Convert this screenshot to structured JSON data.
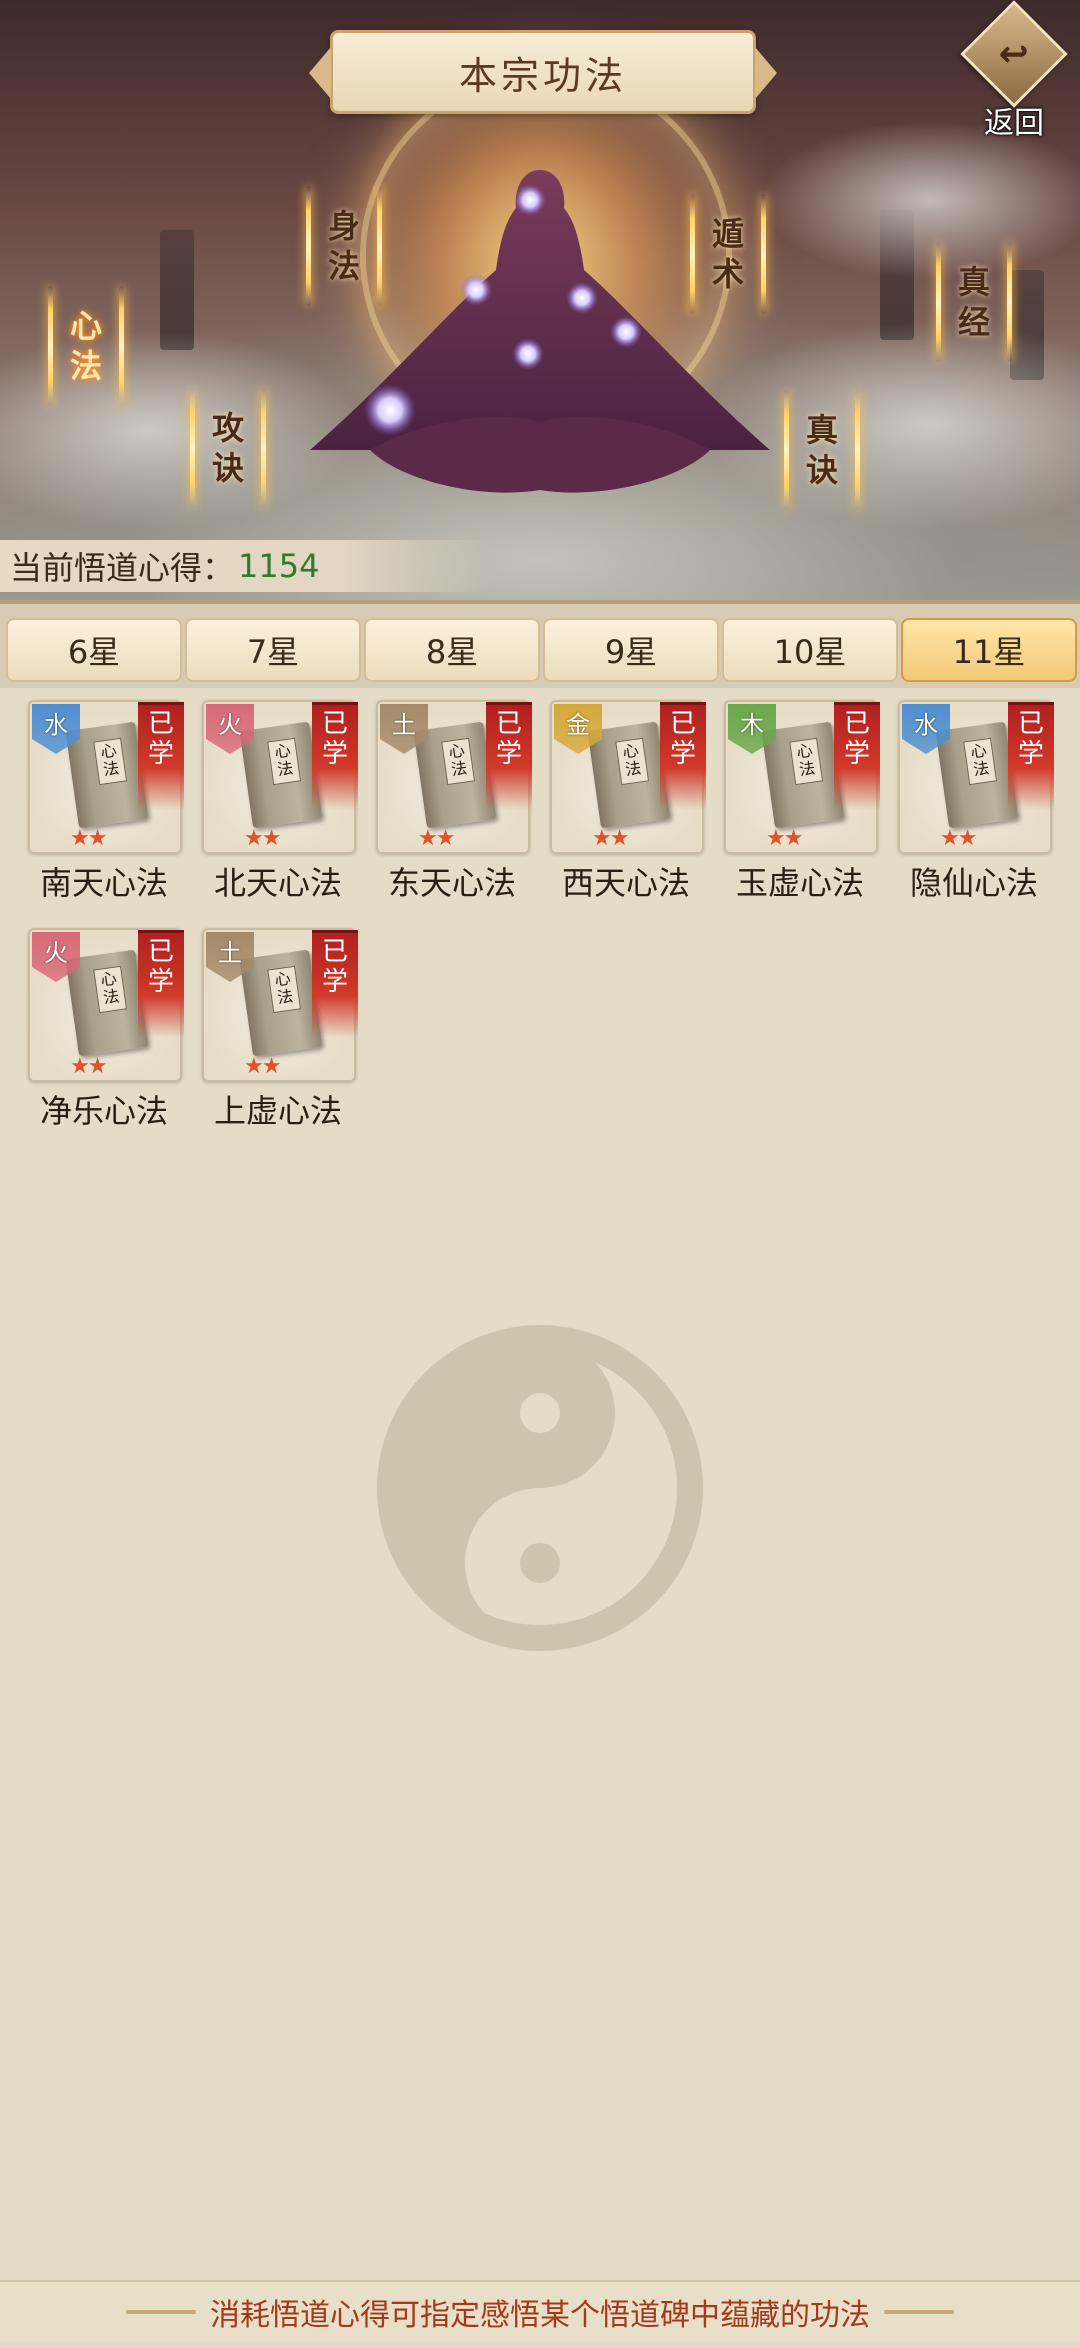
{
  "header": {
    "title": "本宗功法",
    "back_label": "返回"
  },
  "hero": {
    "labels": [
      "心法",
      "身法",
      "攻诀",
      "遁术",
      "真诀",
      "真经"
    ],
    "active_label": "心法"
  },
  "insight": {
    "label": "当前悟道心得：",
    "value": "1154"
  },
  "tabs": [
    "6星",
    "7星",
    "8星",
    "9星",
    "10星",
    "11星"
  ],
  "active_tab": "11星",
  "items": [
    {
      "name": "南天心法",
      "element": "水",
      "status": "已学",
      "stars": 2
    },
    {
      "name": "北天心法",
      "element": "火",
      "status": "已学",
      "stars": 2
    },
    {
      "name": "东天心法",
      "element": "土",
      "status": "已学",
      "stars": 2
    },
    {
      "name": "西天心法",
      "element": "金",
      "status": "已学",
      "stars": 2
    },
    {
      "name": "玉虚心法",
      "element": "木",
      "status": "已学",
      "stars": 2
    },
    {
      "name": "隐仙心法",
      "element": "水",
      "status": "已学",
      "stars": 2
    },
    {
      "name": "净乐心法",
      "element": "火",
      "status": "已学",
      "stars": 2
    },
    {
      "name": "上虚心法",
      "element": "土",
      "status": "已学",
      "stars": 2
    }
  ],
  "book_text": "心法",
  "element_colors": {
    "水": "#4f8fd0",
    "火": "#d86a78",
    "土": "#a58a6a",
    "金": "#d6a83a",
    "木": "#6aa84a"
  },
  "footer": {
    "hint": "消耗悟道心得可指定感悟某个悟道碑中蕴藏的功法"
  }
}
